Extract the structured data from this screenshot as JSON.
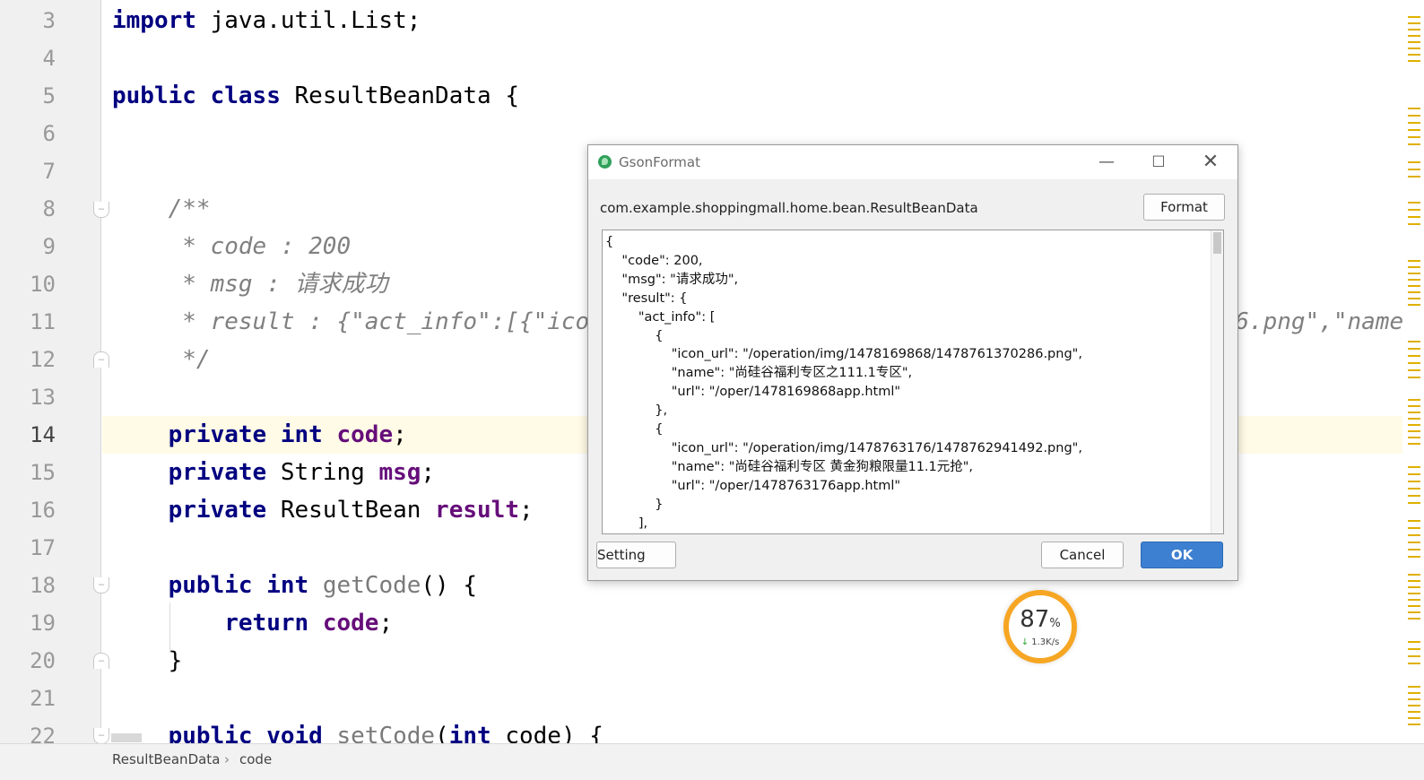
{
  "editor": {
    "line_numbers": [
      "3",
      "4",
      "5",
      "6",
      "7",
      "8",
      "9",
      "10",
      "11",
      "12",
      "13",
      "14",
      "15",
      "16",
      "17",
      "18",
      "19",
      "20",
      "21",
      "22"
    ],
    "lines": {
      "l3": [
        {
          "t": "import",
          "c": "kw"
        },
        {
          "t": " java.util.List;",
          "c": ""
        }
      ],
      "l5": [
        {
          "t": "public",
          "c": "kw"
        },
        {
          "t": " ",
          "c": ""
        },
        {
          "t": "class",
          "c": "kw"
        },
        {
          "t": " ResultBeanData {",
          "c": ""
        }
      ],
      "l8": [
        {
          "t": "    /**",
          "c": "cmt"
        }
      ],
      "l9": [
        {
          "t": "     * code : 200",
          "c": "cmt"
        }
      ],
      "l10": [
        {
          "t": "     * msg : 请求成功",
          "c": "cmt"
        }
      ],
      "l11": [
        {
          "t": "     * result : {\"act_info\":[{\"icon_url\":\"/operation/img/1478169868/1478761370286.png\",\"name",
          "c": "cmt"
        }
      ],
      "l12": [
        {
          "t": "     */",
          "c": "cmt"
        }
      ],
      "l14": [
        {
          "t": "    ",
          "c": ""
        },
        {
          "t": "private",
          "c": "kw"
        },
        {
          "t": " ",
          "c": ""
        },
        {
          "t": "int",
          "c": "kw"
        },
        {
          "t": " ",
          "c": ""
        },
        {
          "t": "code",
          "c": "fld"
        },
        {
          "t": ";",
          "c": ""
        }
      ],
      "l15": [
        {
          "t": "    ",
          "c": ""
        },
        {
          "t": "private",
          "c": "kw"
        },
        {
          "t": " String ",
          "c": ""
        },
        {
          "t": "msg",
          "c": "fld"
        },
        {
          "t": ";",
          "c": ""
        }
      ],
      "l16": [
        {
          "t": "    ",
          "c": ""
        },
        {
          "t": "private",
          "c": "kw"
        },
        {
          "t": " ResultBean ",
          "c": ""
        },
        {
          "t": "result",
          "c": "fld"
        },
        {
          "t": ";",
          "c": ""
        }
      ],
      "l18": [
        {
          "t": "    ",
          "c": ""
        },
        {
          "t": "public",
          "c": "kw"
        },
        {
          "t": " ",
          "c": ""
        },
        {
          "t": "int",
          "c": "kw"
        },
        {
          "t": " ",
          "c": ""
        },
        {
          "t": "getCode",
          "c": "mth"
        },
        {
          "t": "() {",
          "c": ""
        }
      ],
      "l19": [
        {
          "t": "        ",
          "c": ""
        },
        {
          "t": "return",
          "c": "kw"
        },
        {
          "t": " ",
          "c": ""
        },
        {
          "t": "code",
          "c": "fld"
        },
        {
          "t": ";",
          "c": ""
        }
      ],
      "l20": [
        {
          "t": "    }",
          "c": ""
        }
      ],
      "l22": [
        {
          "t": "    ",
          "c": ""
        },
        {
          "t": "public",
          "c": "kw"
        },
        {
          "t": " ",
          "c": ""
        },
        {
          "t": "void",
          "c": "kw"
        },
        {
          "t": " ",
          "c": ""
        },
        {
          "t": "setCode",
          "c": "mth"
        },
        {
          "t": "(",
          "c": ""
        },
        {
          "t": "int",
          "c": "kw"
        },
        {
          "t": " code) {",
          "c": ""
        }
      ]
    }
  },
  "breadcrumb": {
    "class": "ResultBeanData",
    "separator": "›",
    "member": "code"
  },
  "dialog": {
    "title": "GsonFormat",
    "minimize": "—",
    "maximize": "☐",
    "close": "✕",
    "class_name": "com.example.shoppingmall.home.bean.ResultBeanData",
    "format_label": "Format",
    "setting_label": "Setting",
    "cancel_label": "Cancel",
    "ok_label": "OK",
    "json_text": "{\n    \"code\": 200,\n    \"msg\": \"请求成功\",\n    \"result\": {\n        \"act_info\": [\n            {\n                \"icon_url\": \"/operation/img/1478169868/1478761370286.png\",\n                \"name\": \"尚硅谷福利专区之111.1专区\",\n                \"url\": \"/oper/1478169868app.html\"\n            },\n            {\n                \"icon_url\": \"/operation/img/1478763176/1478762941492.png\",\n                \"name\": \"尚硅谷福利专区 黄金狗粮限量11.1元抢\",\n                \"url\": \"/oper/1478763176app.html\"\n            }\n        ],"
  },
  "net_widget": {
    "percent": "87",
    "percent_sign": "%",
    "arrow": "↓",
    "speed": "1.3K/s"
  },
  "colors": {
    "keyword": "#000080",
    "field": "#660e7a",
    "comment": "#808080",
    "current_line": "#fffbe6",
    "ok_button": "#3d7fd0",
    "widget_ring": "#f6a623"
  }
}
